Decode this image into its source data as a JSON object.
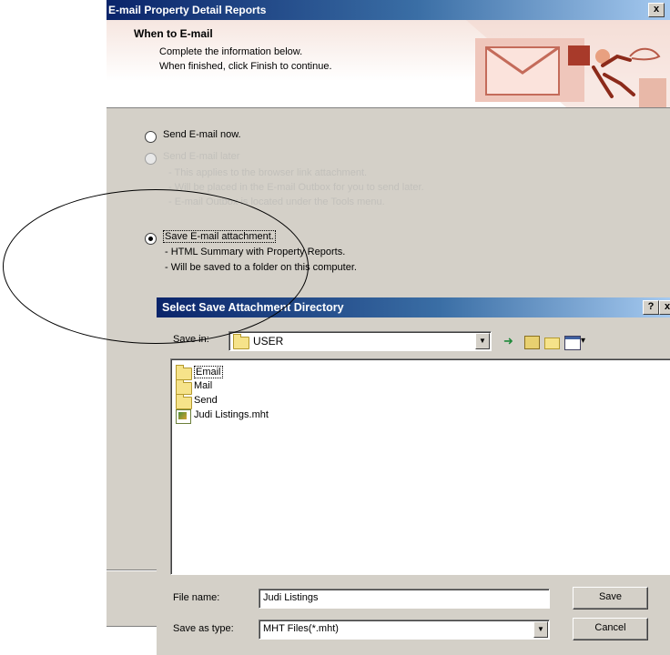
{
  "wizard": {
    "title": "E-mail Property Detail Reports",
    "close": "x",
    "header": {
      "title": "When to E-mail",
      "line1": "Complete the information below.",
      "line2": "When finished, click Finish to continue."
    },
    "options": {
      "send_now": "Send E-mail now.",
      "send_later": "Send E-mail later",
      "send_later_d1": "- This applies to the browser link attachment.",
      "send_later_d2": "- Will be placed in the E-mail Outbox for you to send later.",
      "send_later_d3": "- E-mail Outbox is located under the Tools menu.",
      "save_attach": "Save E-mail attachment.",
      "save_attach_d1": "- HTML Summary with Property Reports.",
      "save_attach_d2": "- Will be saved to a folder on this computer."
    }
  },
  "save_dialog": {
    "title": "Select Save Attachment Directory",
    "help": "?",
    "close": "x",
    "save_in_label": "Save in:",
    "save_in_value": "USER",
    "files": [
      {
        "name": "Email",
        "icon": "folder-icon"
      },
      {
        "name": "Mail",
        "icon": "folder-icon"
      },
      {
        "name": "Send",
        "icon": "folder-icon"
      },
      {
        "name": "Judi Listings.mht",
        "icon": "mht-file-icon"
      }
    ],
    "file_name_label": "File name:",
    "file_name_value": "Judi Listings",
    "save_type_label": "Save as type:",
    "save_type_value": "MHT Files(*.mht)",
    "save_button": "Save",
    "cancel_button": "Cancel"
  }
}
